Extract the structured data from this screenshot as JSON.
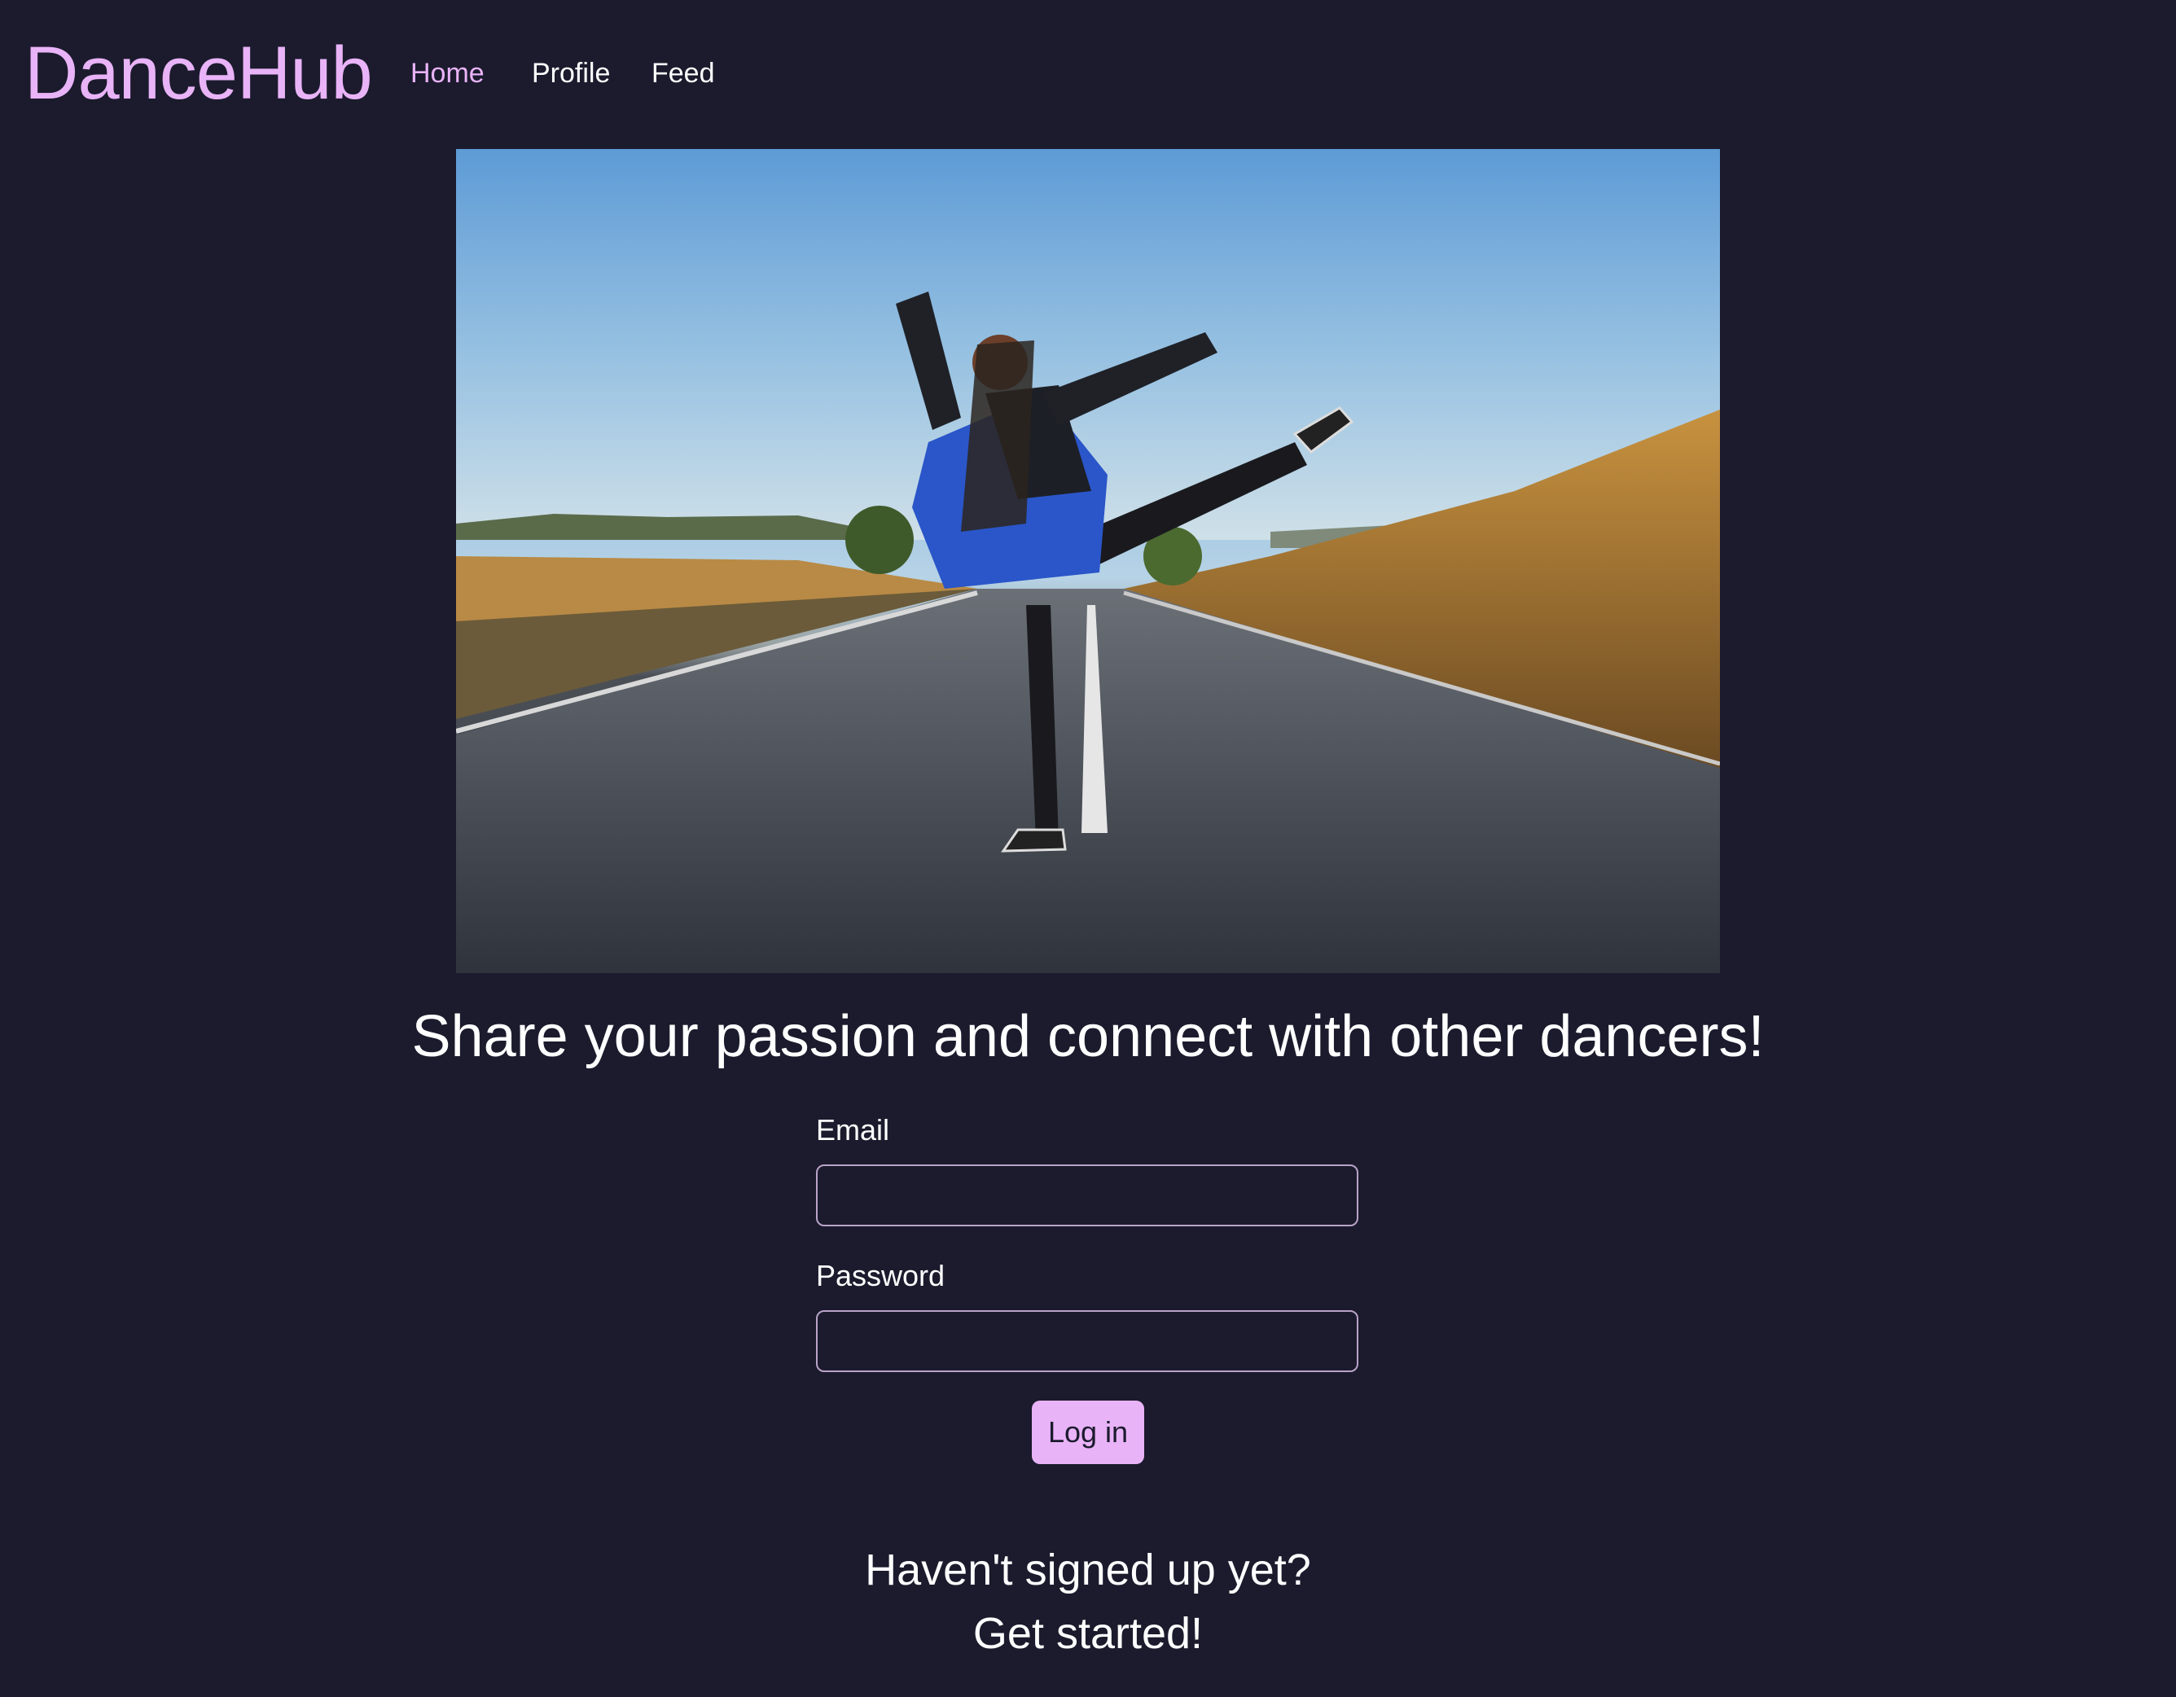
{
  "app": {
    "brand": "DanceHub"
  },
  "nav": {
    "items": [
      {
        "label": "Home",
        "active": true
      },
      {
        "label": "Profile",
        "active": false
      },
      {
        "label": "Feed",
        "active": false
      }
    ]
  },
  "hero": {
    "image": "dancer-on-road-photo"
  },
  "main": {
    "tagline": "Share your passion and connect with other dancers!"
  },
  "login_form": {
    "email_label": "Email",
    "email_value": "",
    "password_label": "Password",
    "password_value": "",
    "submit_label": "Log in"
  },
  "signup": {
    "prompt": "Haven't signed up yet?",
    "cta": "Get started!"
  },
  "colors": {
    "background": "#1b1b2d",
    "accent": "#e9b3f7",
    "input_border": "#b9a3c7",
    "text": "#ffffff"
  }
}
